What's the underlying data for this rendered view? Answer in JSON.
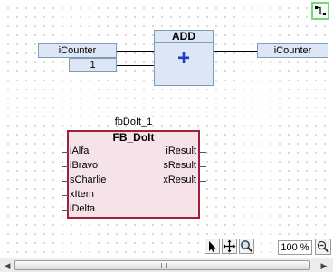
{
  "add_block": {
    "title": "ADD",
    "symbol": "+"
  },
  "inputs": {
    "var1": "iCounter",
    "const1": "1"
  },
  "output": {
    "var": "iCounter"
  },
  "fb": {
    "instance": "fbDoIt_1",
    "type": "FB_DoIt",
    "in_pins": [
      "iAlfa",
      "iBravo",
      "sCharlie",
      "xItem",
      "iDelta"
    ],
    "out_pins": [
      "iResult",
      "sResult",
      "xResult"
    ]
  },
  "toolbar": {
    "select_icon": "arrow-cursor-icon",
    "pan_icon": "move-cross-icon",
    "zoom_icon": "magnifier-icon",
    "zoom_value": "100 %",
    "zoom_button_icon": "zoom-settings-icon",
    "corner_icon": "connect-pin-icon"
  }
}
